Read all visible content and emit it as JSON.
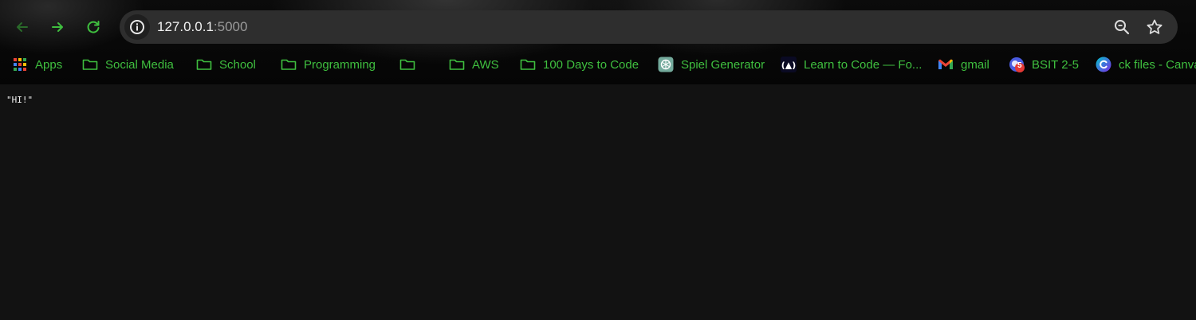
{
  "toolbar": {
    "back_icon": "arrow-left-icon",
    "forward_icon": "arrow-right-icon",
    "reload_icon": "reload-icon",
    "accent": "#3fbf3f"
  },
  "omnibox": {
    "info_icon": "info-icon",
    "url_host": "127.0.0.1",
    "url_port": ":5000",
    "zoom_icon": "zoom-icon",
    "bookmark_icon": "star-icon"
  },
  "bookmarks": [
    {
      "label": "Apps",
      "icon": "apps-grid-icon"
    },
    {
      "label": "Social Media",
      "icon": "folder-icon"
    },
    {
      "label": "School",
      "icon": "folder-icon"
    },
    {
      "label": "Programming",
      "icon": "folder-icon"
    },
    {
      "label": "",
      "icon": "folder-icon"
    },
    {
      "label": "AWS",
      "icon": "folder-icon"
    },
    {
      "label": "100 Days to Code",
      "icon": "folder-icon"
    },
    {
      "label": "Spiel Generator",
      "icon": "chatgpt-icon"
    },
    {
      "label": "Learn to Code — Fo...",
      "icon": "freecodecamp-icon"
    },
    {
      "label": "gmail",
      "icon": "gmail-icon"
    },
    {
      "label": "BSIT 2-5",
      "icon": "badge-5-icon",
      "badge": "5"
    },
    {
      "label": "ck files - Canva",
      "icon": "canva-icon"
    }
  ],
  "page": {
    "content": "\"HI!\""
  }
}
